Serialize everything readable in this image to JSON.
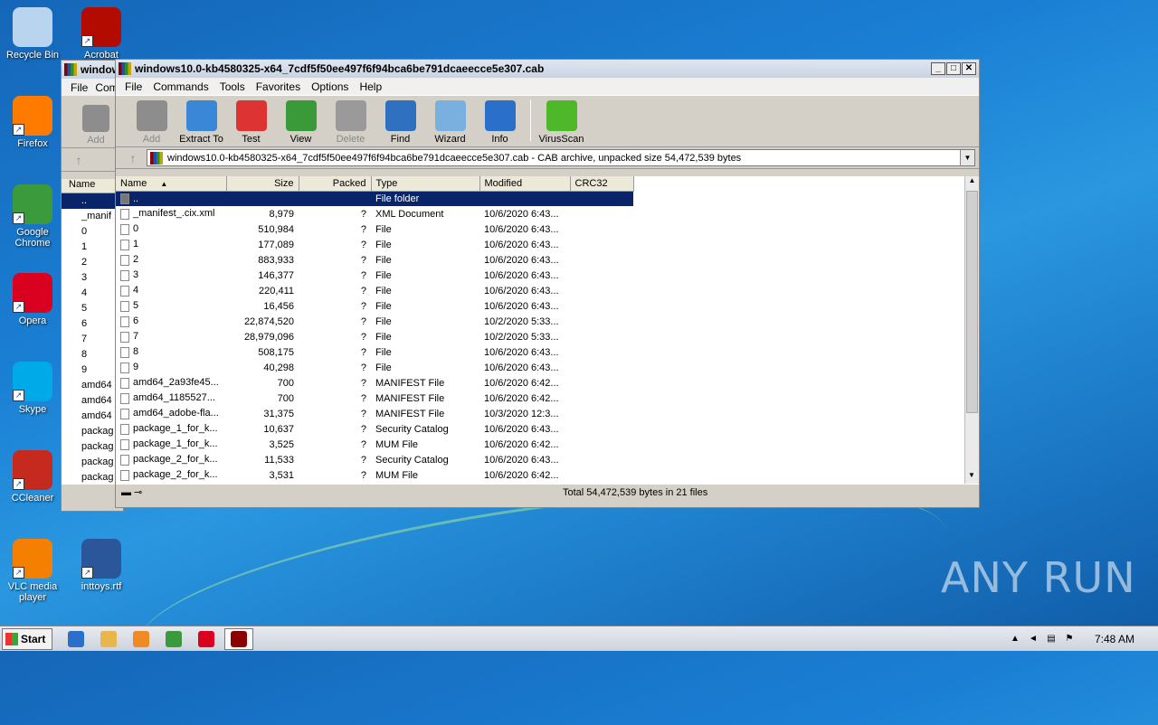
{
  "desktop": {
    "icons": [
      {
        "label": "Recycle Bin",
        "color": "#b9d4ee"
      },
      {
        "label": "Acrobat",
        "color": "#b30b00"
      },
      {
        "label": "Firefox",
        "color": "#ff7b00"
      },
      {
        "label": "Google Chrome",
        "color": "#3b9a3b"
      },
      {
        "label": "Opera",
        "color": "#d90020"
      },
      {
        "label": "Skype",
        "color": "#00a9e8"
      },
      {
        "label": "CCleaner",
        "color": "#c62a1e"
      },
      {
        "label": "VLC media player",
        "color": "#f47f00"
      },
      {
        "label": "inttoys.rtf",
        "color": "#2b579a"
      }
    ],
    "watermark": "ANY RUN"
  },
  "back_window": {
    "title": "window",
    "menu": [
      "File",
      "Com"
    ],
    "tool_add": "Add",
    "column_name": "Name",
    "items": [
      "..",
      "_manif",
      "0",
      "1",
      "2",
      "3",
      "4",
      "5",
      "6",
      "7",
      "8",
      "9",
      "amd64",
      "amd64",
      "amd64",
      "packag",
      "packag",
      "packag",
      "packag"
    ]
  },
  "main_window": {
    "title": "windows10.0-kb4580325-x64_7cdf5f50ee497f6f94bca6be791dcaeecce5e307.cab",
    "menu": [
      "File",
      "Commands",
      "Tools",
      "Favorites",
      "Options",
      "Help"
    ],
    "toolbar": [
      {
        "label": "Add",
        "icon": "add-icon",
        "enabled": false,
        "color": "#8d8d8d"
      },
      {
        "label": "Extract To",
        "icon": "extract-to-icon",
        "enabled": true,
        "color": "#3a87d8"
      },
      {
        "label": "Test",
        "icon": "test-icon",
        "enabled": true,
        "color": "#d33"
      },
      {
        "label": "View",
        "icon": "view-icon",
        "enabled": true,
        "color": "#3a9a3a"
      },
      {
        "label": "Delete",
        "icon": "delete-icon",
        "enabled": false,
        "color": "#9a9a9a"
      },
      {
        "label": "Find",
        "icon": "find-icon",
        "enabled": true,
        "color": "#3070c0"
      },
      {
        "label": "Wizard",
        "icon": "wizard-icon",
        "enabled": true,
        "color": "#7ab0e0"
      },
      {
        "label": "Info",
        "icon": "info-icon",
        "enabled": true,
        "color": "#2a6fc9"
      },
      {
        "label": "VirusScan",
        "icon": "virusscan-icon",
        "enabled": true,
        "color": "#4cb82a"
      }
    ],
    "address": "windows10.0-kb4580325-x64_7cdf5f50ee497f6f94bca6be791dcaeecce5e307.cab - CAB archive, unpacked size 54,472,539 bytes",
    "columns": [
      "Name",
      "Size",
      "Packed",
      "Type",
      "Modified",
      "CRC32"
    ],
    "rows": [
      {
        "name": "..",
        "size": "",
        "packed": "",
        "type": "File folder",
        "modified": "",
        "crc": ""
      },
      {
        "name": "_manifest_.cix.xml",
        "size": "8,979",
        "packed": "?",
        "type": "XML Document",
        "modified": "10/6/2020 6:43...",
        "crc": ""
      },
      {
        "name": "0",
        "size": "510,984",
        "packed": "?",
        "type": "File",
        "modified": "10/6/2020 6:43...",
        "crc": ""
      },
      {
        "name": "1",
        "size": "177,089",
        "packed": "?",
        "type": "File",
        "modified": "10/6/2020 6:43...",
        "crc": ""
      },
      {
        "name": "2",
        "size": "883,933",
        "packed": "?",
        "type": "File",
        "modified": "10/6/2020 6:43...",
        "crc": ""
      },
      {
        "name": "3",
        "size": "146,377",
        "packed": "?",
        "type": "File",
        "modified": "10/6/2020 6:43...",
        "crc": ""
      },
      {
        "name": "4",
        "size": "220,411",
        "packed": "?",
        "type": "File",
        "modified": "10/6/2020 6:43...",
        "crc": ""
      },
      {
        "name": "5",
        "size": "16,456",
        "packed": "?",
        "type": "File",
        "modified": "10/6/2020 6:43...",
        "crc": ""
      },
      {
        "name": "6",
        "size": "22,874,520",
        "packed": "?",
        "type": "File",
        "modified": "10/2/2020 5:33...",
        "crc": ""
      },
      {
        "name": "7",
        "size": "28,979,096",
        "packed": "?",
        "type": "File",
        "modified": "10/2/2020 5:33...",
        "crc": ""
      },
      {
        "name": "8",
        "size": "508,175",
        "packed": "?",
        "type": "File",
        "modified": "10/6/2020 6:43...",
        "crc": ""
      },
      {
        "name": "9",
        "size": "40,298",
        "packed": "?",
        "type": "File",
        "modified": "10/6/2020 6:43...",
        "crc": ""
      },
      {
        "name": "amd64_2a93fe45...",
        "size": "700",
        "packed": "?",
        "type": "MANIFEST File",
        "modified": "10/6/2020 6:42...",
        "crc": ""
      },
      {
        "name": "amd64_1185527...",
        "size": "700",
        "packed": "?",
        "type": "MANIFEST File",
        "modified": "10/6/2020 6:42...",
        "crc": ""
      },
      {
        "name": "amd64_adobe-fla...",
        "size": "31,375",
        "packed": "?",
        "type": "MANIFEST File",
        "modified": "10/3/2020 12:3...",
        "crc": ""
      },
      {
        "name": "package_1_for_k...",
        "size": "10,637",
        "packed": "?",
        "type": "Security Catalog",
        "modified": "10/6/2020 6:43...",
        "crc": ""
      },
      {
        "name": "package_1_for_k...",
        "size": "3,525",
        "packed": "?",
        "type": "MUM File",
        "modified": "10/6/2020 6:42...",
        "crc": ""
      },
      {
        "name": "package_2_for_k...",
        "size": "11,533",
        "packed": "?",
        "type": "Security Catalog",
        "modified": "10/6/2020 6:43...",
        "crc": ""
      },
      {
        "name": "package_2_for_k...",
        "size": "3,531",
        "packed": "?",
        "type": "MUM File",
        "modified": "10/6/2020 6:42...",
        "crc": ""
      }
    ],
    "status": "Total 54,472,539 bytes in 21 files"
  },
  "taskbar": {
    "start_label": "Start",
    "items": [
      {
        "name": "ie",
        "color": "#2a6fc9"
      },
      {
        "name": "explorer",
        "color": "#e8b64a"
      },
      {
        "name": "media",
        "color": "#f08a24"
      },
      {
        "name": "chrome",
        "color": "#3b9a3b"
      },
      {
        "name": "opera",
        "color": "#d90020"
      },
      {
        "name": "winrar",
        "color": "#8b0000"
      }
    ],
    "clock": "7:48 AM"
  }
}
